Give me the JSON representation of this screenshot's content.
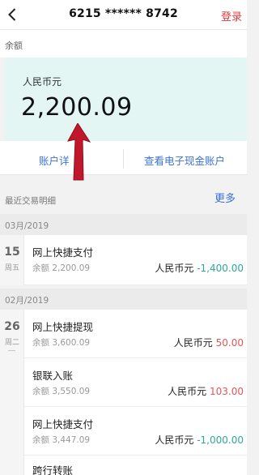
{
  "header": {
    "back_icon": "chevron-left-icon",
    "title": "6215 ****** 8742",
    "login_label": "登录",
    "accent_color": "#e03b3b"
  },
  "balance": {
    "label": "余额",
    "currency": "人民币元",
    "amount": "2,200.09"
  },
  "actions": {
    "account_details": "账户详",
    "ecash_account": "查看电子现金账户",
    "link_color": "#3b72d9"
  },
  "recent": {
    "label": "最近交易明细",
    "more": "更多"
  },
  "months": [
    {
      "label": "03月/2019",
      "days": [
        {
          "day": "15",
          "weekday": "周五",
          "transactions": [
            {
              "name": "网上快捷支付",
              "balance": "余额 2,200.09",
              "currency": "人民币元",
              "amount": "-1,400.00"
            }
          ]
        }
      ]
    },
    {
      "label": "02月/2019",
      "days": [
        {
          "day": "26",
          "weekday": "周二",
          "transactions": [
            {
              "name": "网上快捷提现",
              "balance": "余额 3,600.09",
              "currency": "人民币元",
              "amount": "50.00"
            },
            {
              "name": "银联入账",
              "balance": "余额 3,550.09",
              "currency": "人民币元",
              "amount": "103.00"
            },
            {
              "name": "网上快捷支付",
              "balance": "余额 3,447.09",
              "currency": "人民币元",
              "amount": "-1,000.00"
            },
            {
              "name": "跨行转账",
              "balance": "",
              "currency": "",
              "amount": ""
            }
          ]
        }
      ]
    }
  ],
  "colors": {
    "negative": "#2fa89a",
    "positive": "#e05656",
    "card_bg": "#e3f6f4"
  }
}
